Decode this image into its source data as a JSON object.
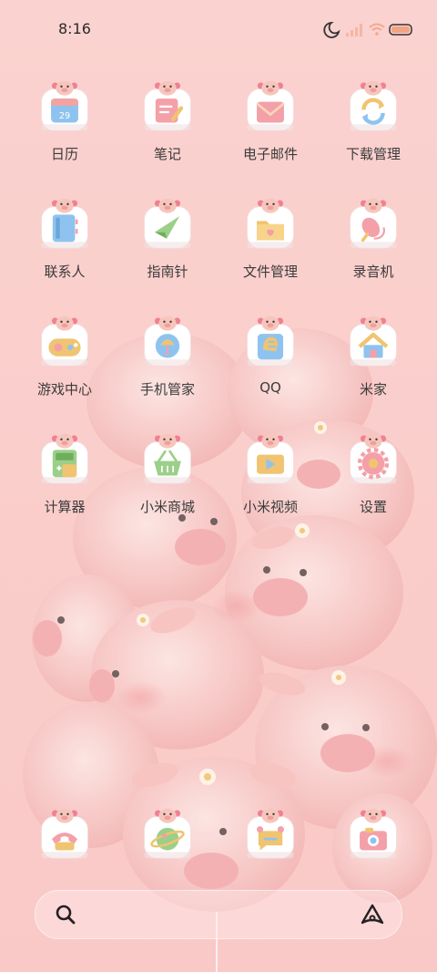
{
  "status_bar": {
    "time": "8:16"
  },
  "apps": [
    {
      "name": "calendar",
      "label": "日历"
    },
    {
      "name": "notes",
      "label": "笔记"
    },
    {
      "name": "email",
      "label": "电子邮件"
    },
    {
      "name": "downloads",
      "label": "下载管理"
    },
    {
      "name": "contacts",
      "label": "联系人"
    },
    {
      "name": "compass",
      "label": "指南针"
    },
    {
      "name": "file-manager",
      "label": "文件管理"
    },
    {
      "name": "recorder",
      "label": "录音机"
    },
    {
      "name": "game-center",
      "label": "游戏中心"
    },
    {
      "name": "phone-manager",
      "label": "手机管家"
    },
    {
      "name": "qq",
      "label": "QQ"
    },
    {
      "name": "mi-home",
      "label": "米家"
    },
    {
      "name": "calculator",
      "label": "计算器"
    },
    {
      "name": "mi-store",
      "label": "小米商城"
    },
    {
      "name": "mi-video",
      "label": "小米视频"
    },
    {
      "name": "settings",
      "label": "设置"
    }
  ],
  "dock": [
    {
      "name": "phone"
    },
    {
      "name": "browser"
    },
    {
      "name": "messages"
    },
    {
      "name": "camera"
    }
  ]
}
